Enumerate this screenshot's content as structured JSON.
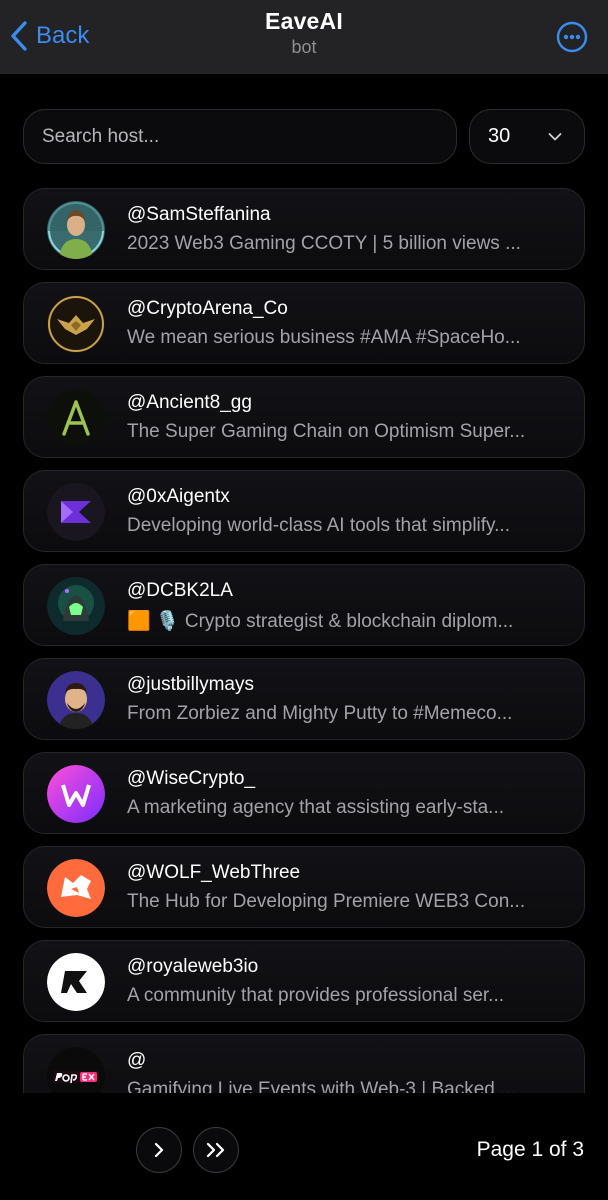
{
  "header": {
    "back_label": "Back",
    "title": "EaveAI",
    "subtitle": "bot"
  },
  "controls": {
    "search_placeholder": "Search host...",
    "page_size": "30"
  },
  "hosts": [
    {
      "handle": "@SamSteffanina",
      "bio": "2023 Web3 Gaming CCOTY | 5 billion views ...",
      "avatar": "person-photo"
    },
    {
      "handle": "@CryptoArena_Co",
      "bio": "We mean serious business #AMA #SpaceHo...",
      "avatar": "gold-eagle-logo"
    },
    {
      "handle": "@Ancient8_gg",
      "bio": "The Super Gaming Chain on Optimism Super...",
      "avatar": "letter-a-logo"
    },
    {
      "handle": "@0xAigentx",
      "bio": "Developing world-class AI tools that simplify...",
      "avatar": "purple-x-logo"
    },
    {
      "handle": "@DCBK2LA",
      "bio": "🟧 🎙️ Crypto strategist & blockchain diplom...",
      "avatar": "hooded-character"
    },
    {
      "handle": "@justbillymays",
      "bio": "From Zorbiez and Mighty Putty to #Memeco...",
      "avatar": "cartoon-man"
    },
    {
      "handle": "@WiseCrypto_",
      "bio": "A marketing agency that assisting early-sta...",
      "avatar": "w-gradient-logo"
    },
    {
      "handle": "@WOLF_WebThree",
      "bio": "The Hub for Developing Premiere WEB3 Con...",
      "avatar": "wolf-logo"
    },
    {
      "handle": "@royaleweb3io",
      "bio": "A community that provides professional ser...",
      "avatar": "royale-logo"
    },
    {
      "handle": "@",
      "bio": "Gamifying Live Events with Web-3 | Backed ...",
      "avatar": "popex-logo"
    }
  ],
  "pagination": {
    "label": "Page 1 of 3",
    "next_icon": "chevron-right-icon",
    "last_icon": "double-chevron-right-icon"
  },
  "colors": {
    "accent": "#3a8cf0",
    "header_bg": "#232325",
    "card_border": "#26262a",
    "muted_text": "#a2a2a8"
  }
}
